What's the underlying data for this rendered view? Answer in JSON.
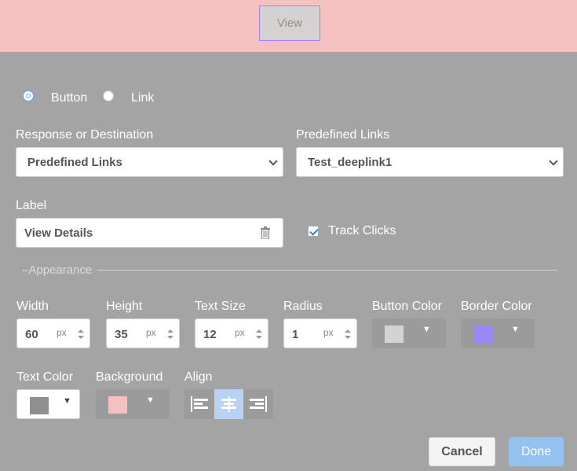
{
  "preview": {
    "button_label": "View",
    "background": "#f4c0c0",
    "border_color": "#9b87f5"
  },
  "type_options": [
    {
      "label": "Button",
      "selected": true
    },
    {
      "label": "Link",
      "selected": false
    }
  ],
  "response": {
    "label": "Response or Destination",
    "value": "Predefined Links"
  },
  "predefined": {
    "label": "Predefined Links",
    "value": "Test_deeplink1"
  },
  "label_field": {
    "label": "Label",
    "value": "View Details",
    "icon": "trash-icon"
  },
  "track_clicks": {
    "label": "Track Clicks",
    "checked": true
  },
  "appearance": {
    "title": "Appearance"
  },
  "dimensions": [
    {
      "label": "Width",
      "value": "60",
      "unit": "px"
    },
    {
      "label": "Height",
      "value": "35",
      "unit": "px"
    },
    {
      "label": "Text Size",
      "value": "12",
      "unit": "px"
    },
    {
      "label": "Radius",
      "value": "1",
      "unit": "px"
    }
  ],
  "colors": {
    "button_color": {
      "label": "Button Color",
      "value": "#d5d2d2"
    },
    "border_color": {
      "label": "Border Color",
      "value": "#9b87f5"
    },
    "text_color": {
      "label": "Text Color",
      "value": "#8f8f8f"
    },
    "background": {
      "label": "Background",
      "value": "#f4c0c0"
    }
  },
  "align": {
    "label": "Align",
    "options": [
      "left",
      "center",
      "right"
    ],
    "selected": "center"
  },
  "actions": {
    "cancel": "Cancel",
    "done": "Done"
  }
}
